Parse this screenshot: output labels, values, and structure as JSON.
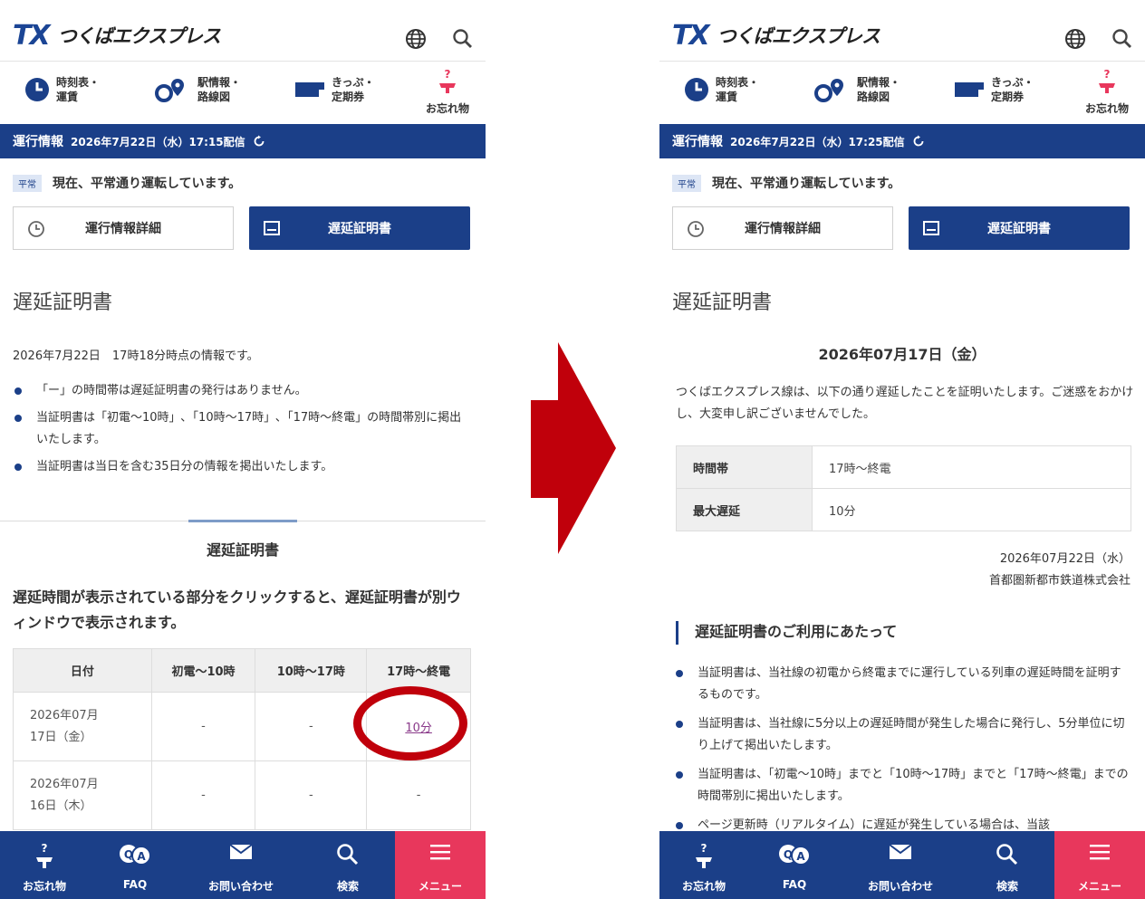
{
  "header": {
    "logo_tx": "TX",
    "logo_name": "つくばエクスプレス"
  },
  "quick_nav": {
    "timetable": "時刻表・\n運賃",
    "station": "駅情報・\n路線図",
    "ticket": "きっぷ・\n定期券",
    "lost": "お忘れ物"
  },
  "left": {
    "operation": {
      "title": "運行情報",
      "time": "2026年7月22日（水）17:15配信"
    },
    "status": {
      "badge": "平常",
      "text": "現在、平常通り運転しています。"
    },
    "buttons": {
      "detail": "運行情報詳細",
      "certificate": "遅延証明書"
    },
    "section_title": "遅延証明書",
    "info_date": "2026年7月22日　17時18分時点の情報です。",
    "notes": [
      "「ー」の時間帯は遅延証明書の発行はありません。",
      "当証明書は「初電～10時」､「10時～17時」､「17時～終電」の時間帯別に掲出いたします。",
      "当証明書は当日を含む35日分の情報を掲出いたします。"
    ],
    "tab_title": "遅延証明書",
    "description": "遅延時間が表示されている部分をクリックすると、遅延証明書が別ウィンドウで表示されます。",
    "table": {
      "headers": [
        "日付",
        "初電～10時",
        "10時～17時",
        "17時～終電"
      ],
      "rows": [
        {
          "date": "2026年07月\n17日（金）",
          "c1": "-",
          "c2": "-",
          "c3": "10分"
        },
        {
          "date": "2026年07月\n16日（木）",
          "c1": "-",
          "c2": "-",
          "c3": "-"
        }
      ]
    }
  },
  "right": {
    "operation": {
      "title": "運行情報",
      "time": "2026年7月22日（水）17:25配信"
    },
    "status": {
      "badge": "平常",
      "text": "現在、平常通り運転しています。"
    },
    "buttons": {
      "detail": "運行情報詳細",
      "certificate": "遅延証明書"
    },
    "section_title": "遅延証明書",
    "certificate_date": "2026年07月17日（金）",
    "certificate_text": "つくばエクスプレス線は、以下の通り遅延したことを証明いたします。ご迷惑をおかけし、大変申し訳ございませんでした。",
    "certificate_table": [
      {
        "label": "時間帯",
        "value": "17時～終電"
      },
      {
        "label": "最大遅延",
        "value": "10分"
      }
    ],
    "issued_date": "2026年07月22日（水）",
    "issuer": "首都圏新都市鉄道株式会社",
    "usage_heading": "遅延証明書のご利用にあたって",
    "usage_notes": [
      "当証明書は、当社線の初電から終電までに運行している列車の遅延時間を証明するものです。",
      "当証明書は、当社線に5分以上の遅延時間が発生した場合に発行し、5分単位に切り上げて掲出いたします。",
      "当証明書は、「初電～10時」までと「10時～17時」までと「17時～終電」までの時間帯別に掲出いたします。",
      "ページ更新時（リアルタイム）に遅延が発生している場合は、当該"
    ]
  },
  "bottom_nav": [
    "お忘れ物",
    "FAQ",
    "お問い合わせ",
    "検索",
    "メニュー"
  ],
  "colors": {
    "brand_navy": "#1b3f88",
    "menu_pink": "#e8375c",
    "arrow_red": "#c0000b"
  }
}
